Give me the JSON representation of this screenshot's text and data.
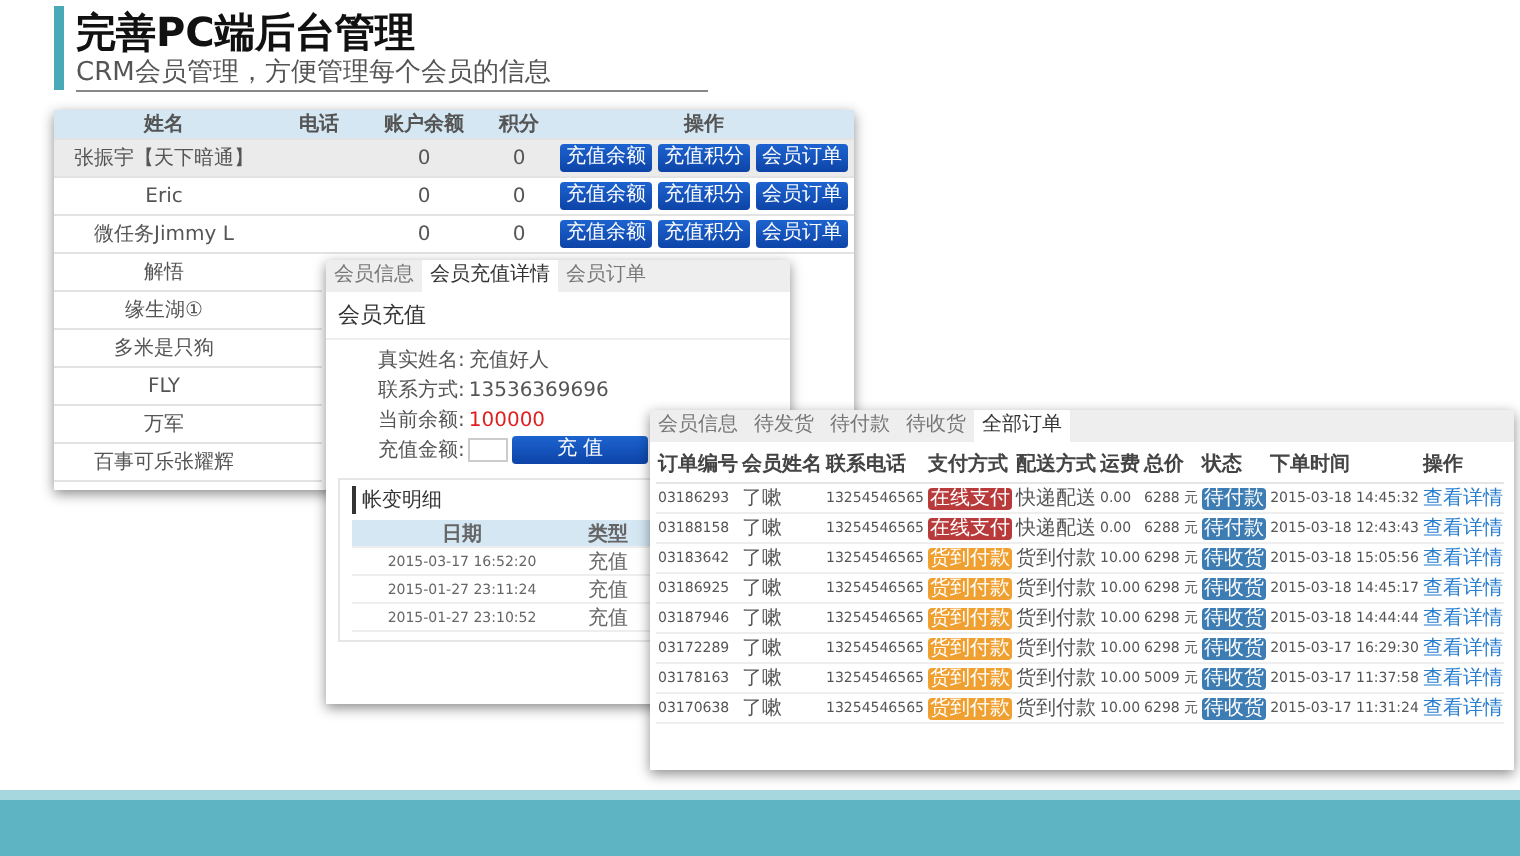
{
  "title": "完善PC端后台管理",
  "subtitle": "CRM会员管理，方便管理每个会员的信息",
  "member_list": {
    "columns": [
      "姓名",
      "电话",
      "账户余额",
      "积分",
      "操作"
    ],
    "rows": [
      {
        "name": "张振宇【天下暗通】",
        "balance": "0",
        "points": "0",
        "actions": [
          "充值余额",
          "充值积分",
          "会员订单"
        ],
        "selected": true
      },
      {
        "name": "Eric",
        "balance": "0",
        "points": "0",
        "actions": [
          "充值余额",
          "充值积分",
          "会员订单"
        ],
        "selected": false
      },
      {
        "name": "微任务Jimmy L",
        "balance": "0",
        "points": "0",
        "actions": [
          "充值余额",
          "充值积分",
          "会员订单"
        ],
        "selected": false
      },
      {
        "name": "解悟",
        "selected": false
      },
      {
        "name": "缘生湖①",
        "selected": false
      },
      {
        "name": "多米是只狗",
        "selected": false
      },
      {
        "name": "FLY",
        "selected": false
      },
      {
        "name": "万军",
        "selected": false
      },
      {
        "name": "百事可乐张耀辉",
        "selected": false
      }
    ]
  },
  "recharge_window": {
    "tabs": [
      {
        "label": "会员信息",
        "selected": false
      },
      {
        "label": "会员充值详情",
        "selected": true
      },
      {
        "label": "会员订单",
        "selected": false
      }
    ],
    "heading": "会员充值",
    "fields": [
      {
        "kind": "text",
        "label": "真实姓名:",
        "value": "充值好人"
      },
      {
        "kind": "text",
        "label": "联系方式:",
        "value": "13536369696"
      },
      {
        "kind": "amount",
        "label": "当前余额:",
        "value": "100000"
      },
      {
        "kind": "input",
        "label": "充值金额:",
        "button": "充 值"
      }
    ],
    "section_title": "帐变明细",
    "columns": [
      "日期",
      "类型"
    ],
    "rows": [
      [
        "2015-03-17 16:52:20",
        "充值"
      ],
      [
        "2015-01-27 23:11:24",
        "充值"
      ],
      [
        "2015-01-27 23:10:52",
        "充值"
      ]
    ]
  },
  "orders_window": {
    "tabs": [
      {
        "label": "会员信息",
        "selected": false
      },
      {
        "label": "待发货",
        "selected": false
      },
      {
        "label": "待付款",
        "selected": false
      },
      {
        "label": "待收货",
        "selected": false
      },
      {
        "label": "全部订单",
        "selected": true
      }
    ],
    "columns": [
      "订单编号",
      "会员姓名",
      "联系电话",
      "支付方式",
      "配送方式",
      "运费",
      "总价",
      "状态",
      "下单时间",
      "操作"
    ],
    "rows": [
      {
        "id": "03186293",
        "name": "了嗽",
        "phone": "13254546565",
        "pay": {
          "text": "在线支付",
          "color": "#b83a3a"
        },
        "delivery": "快递配送",
        "fee": "0.00",
        "total": "6288 元",
        "status": {
          "text": "待付款",
          "color": "#3d7db3"
        },
        "time": "2015-03-18 14:45:32",
        "action": "查看详情"
      },
      {
        "id": "03188158",
        "name": "了嗽",
        "phone": "13254546565",
        "pay": {
          "text": "在线支付",
          "color": "#b83a3a"
        },
        "delivery": "快递配送",
        "fee": "0.00",
        "total": "6288 元",
        "status": {
          "text": "待付款",
          "color": "#3d7db3"
        },
        "time": "2015-03-18 12:43:43",
        "action": "查看详情"
      },
      {
        "id": "03183642",
        "name": "了嗽",
        "phone": "13254546565",
        "pay": {
          "text": "货到付款",
          "color": "#f0a030"
        },
        "delivery": "货到付款",
        "fee": "10.00",
        "total": "6298 元",
        "status": {
          "text": "待收货",
          "color": "#3d7db3"
        },
        "time": "2015-03-18 15:05:56",
        "action": "查看详情"
      },
      {
        "id": "03186925",
        "name": "了嗽",
        "phone": "13254546565",
        "pay": {
          "text": "货到付款",
          "color": "#f0a030"
        },
        "delivery": "货到付款",
        "fee": "10.00",
        "total": "6298 元",
        "status": {
          "text": "待收货",
          "color": "#3d7db3"
        },
        "time": "2015-03-18 14:45:17",
        "action": "查看详情"
      },
      {
        "id": "03187946",
        "name": "了嗽",
        "phone": "13254546565",
        "pay": {
          "text": "货到付款",
          "color": "#f0a030"
        },
        "delivery": "货到付款",
        "fee": "10.00",
        "total": "6298 元",
        "status": {
          "text": "待收货",
          "color": "#3d7db3"
        },
        "time": "2015-03-18 14:44:44",
        "action": "查看详情"
      },
      {
        "id": "03172289",
        "name": "了嗽",
        "phone": "13254546565",
        "pay": {
          "text": "货到付款",
          "color": "#f0a030"
        },
        "delivery": "货到付款",
        "fee": "10.00",
        "total": "6298 元",
        "status": {
          "text": "待收货",
          "color": "#3d7db3"
        },
        "time": "2015-03-17 16:29:30",
        "action": "查看详情"
      },
      {
        "id": "03178163",
        "name": "了嗽",
        "phone": "13254546565",
        "pay": {
          "text": "货到付款",
          "color": "#f0a030"
        },
        "delivery": "货到付款",
        "fee": "10.00",
        "total": "5009 元",
        "status": {
          "text": "待收货",
          "color": "#3d7db3"
        },
        "time": "2015-03-17 11:37:58",
        "action": "查看详情"
      },
      {
        "id": "03170638",
        "name": "了嗽",
        "phone": "13254546565",
        "pay": {
          "text": "货到付款",
          "color": "#f0a030"
        },
        "delivery": "货到付款",
        "fee": "10.00",
        "total": "6298 元",
        "status": {
          "text": "待收货",
          "color": "#3d7db3"
        },
        "time": "2015-03-17 11:31:24",
        "action": "查看详情"
      }
    ]
  }
}
